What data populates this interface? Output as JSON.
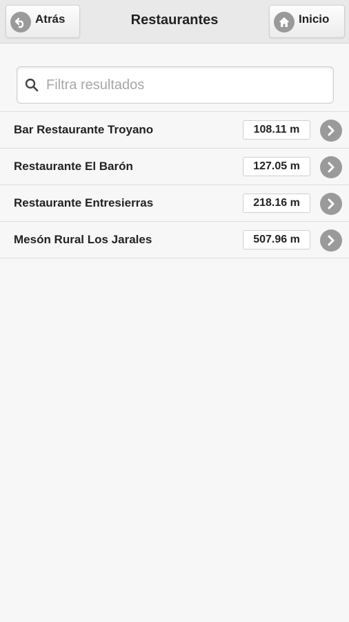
{
  "header": {
    "back_label": "Atrás",
    "title": "Restaurantes",
    "home_label": "Inicio"
  },
  "search": {
    "placeholder": "Filtra resultados",
    "value": ""
  },
  "restaurants": [
    {
      "name": "Bar Restaurante Troyano",
      "distance": "108.11 m"
    },
    {
      "name": "Restaurante El Barón",
      "distance": "127.05 m"
    },
    {
      "name": "Restaurante Entresierras",
      "distance": "218.16 m"
    },
    {
      "name": "Mesón Rural Los Jarales",
      "distance": "507.96 m"
    }
  ],
  "colors": {
    "icon_gray": "#9a9a9a",
    "background": "#f7f7f7",
    "header_bg": "#e9e9e9"
  }
}
